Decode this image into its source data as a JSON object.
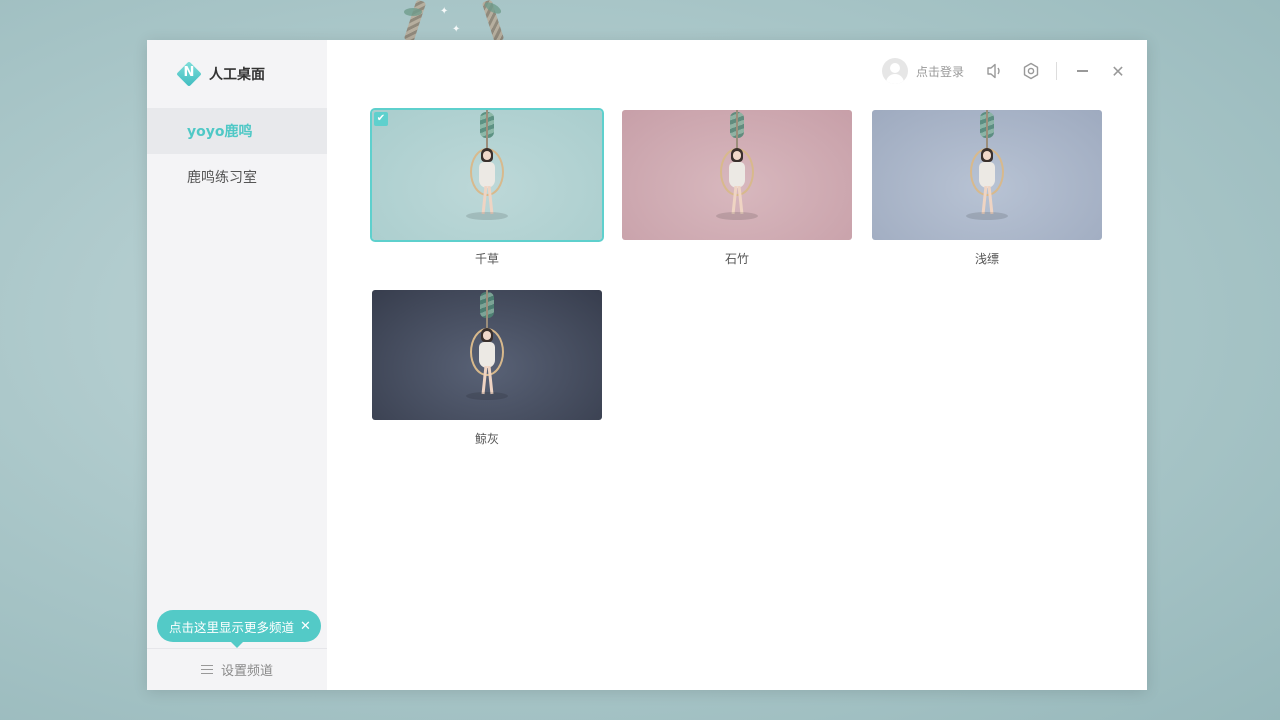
{
  "app": {
    "title": "人工桌面",
    "logo_letter": "N",
    "logo_icon": "diamond-logo-icon",
    "accent_color": "#53cac7"
  },
  "sidebar": {
    "items": [
      {
        "label": "yoyo鹿鸣",
        "active": true
      },
      {
        "label": "鹿鸣练习室",
        "active": false
      }
    ],
    "tip": {
      "text": "点击这里显示更多频道",
      "close_glyph": "✕"
    },
    "footer": {
      "label": "设置频道",
      "icon": "menu-icon"
    }
  },
  "topbar": {
    "login_label": "点击登录",
    "icons": [
      "avatar-icon",
      "volume-icon",
      "settings-icon",
      "minimize-icon",
      "close-icon"
    ],
    "close_glyph": "✕"
  },
  "wallpapers": [
    {
      "name": "千草",
      "selected": true,
      "colors": [
        "#a9cdcd",
        "#bdd8d8"
      ]
    },
    {
      "name": "石竹",
      "selected": false,
      "colors": [
        "#c79fa8",
        "#d8b8be"
      ]
    },
    {
      "name": "浅缥",
      "selected": false,
      "colors": [
        "#9eaabf",
        "#b8c3d4"
      ]
    },
    {
      "name": "鲸灰",
      "selected": false,
      "colors": [
        "#373d4d",
        "#596276"
      ]
    }
  ],
  "check_glyph": "✔"
}
